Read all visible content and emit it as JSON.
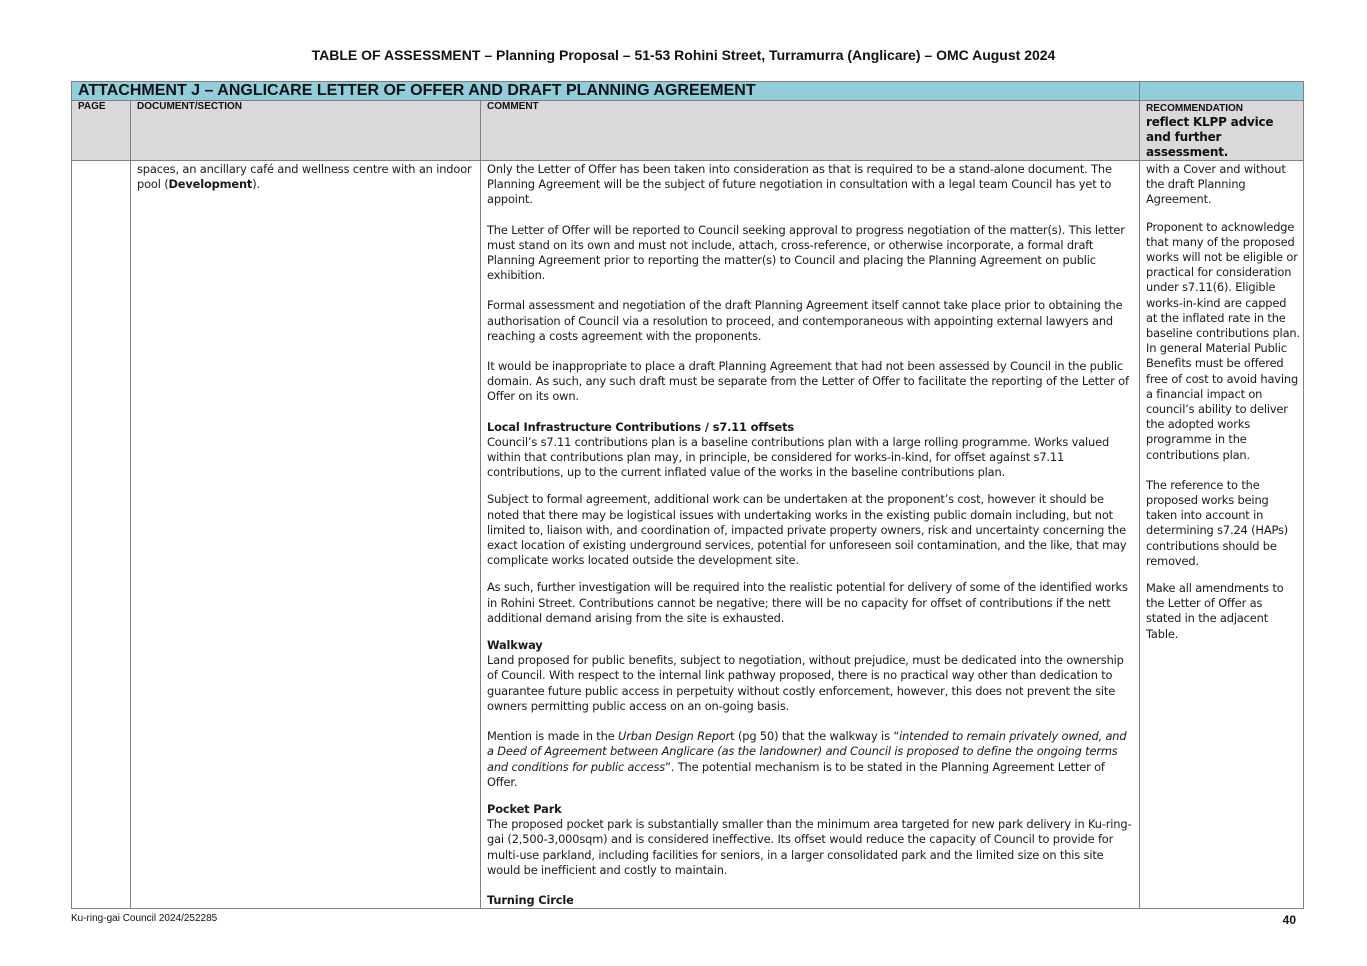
{
  "document": {
    "title": "TABLE OF ASSESSMENT – Planning Proposal – 51-53 Rohini Street, Turramurra (Anglicare) – OMC August 2024"
  },
  "table": {
    "attachment_title": "ATTACHMENT J – ANGLICARE LETTER OF OFFER AND DRAFT PLANNING AGREEMENT",
    "headers": {
      "page": "PAGE",
      "document_section": "DOCUMENT/SECTION",
      "comment": "COMMENT",
      "recommendation": "RECOMMENDATION",
      "recommendation_sub": "reflect KLPP advice and further assessment."
    },
    "row": {
      "page": "",
      "section_text_1": "spaces, an ancillary café and wellness centre with an indoor pool (",
      "section_bold": "Development",
      "section_text_2": ").",
      "comment": {
        "p1": "Only the Letter of Offer has been taken into consideration as that is required to be a stand-alone document. The Planning Agreement will be the subject of future negotiation in consultation with a legal team Council has yet to appoint.",
        "p2": "The Letter of Offer will be reported to Council seeking approval to progress negotiation of the matter(s). This letter must stand on its own and must not include, attach, cross-reference, or otherwise incorporate, a formal draft Planning Agreement prior to reporting the matter(s) to Council and placing the Planning Agreement on public exhibition.",
        "p3": "Formal assessment and negotiation of the draft Planning Agreement itself cannot take place prior to obtaining the authorisation of Council via a resolution to proceed, and contemporaneous with appointing external lawyers and reaching a costs agreement with the proponents.",
        "p4": "It would be inappropriate to place a draft Planning Agreement that had not been assessed by Council in the public domain. As such, any such draft must be separate from the Letter of Offer to facilitate the reporting of the Letter of Offer on its own.",
        "h_contrib": "Local Infrastructure Contributions / s7.11 offsets",
        "p5": "Council’s s7.11 contributions plan is a baseline contributions plan with a large rolling programme. Works valued within that contributions plan may, in principle, be considered for works-in-kind, for offset against s7.11 contributions, up to the current inflated value of the works in the baseline contributions plan.",
        "p6": "Subject to formal agreement, additional work can be undertaken at the proponent’s cost, however it should be noted that there may be logistical issues with undertaking works in the existing public domain including, but not limited to, liaison with, and coordination of, impacted private property owners, risk and uncertainty concerning the exact location of existing underground services, potential for unforeseen soil contamination, and the like, that may complicate works located outside the development site.",
        "p7": "As such, further investigation will be required into the realistic potential for delivery of some of the identified works in Rohini Street. Contributions cannot be negative; there will be no capacity for offset of contributions if the nett additional demand arising from the site is exhausted.",
        "h_walkway": "Walkway",
        "p8": "Land proposed for public benefits, subject to negotiation, without prejudice, must be dedicated into the ownership of Council. With respect to the internal link pathway proposed, there is no practical way other than dedication to guarantee future public access in perpetuity without costly enforcement, however, this does not prevent the site owners permitting public access on an on-going basis.",
        "p9_a": "Mention is made in the ",
        "p9_b": "Urban Design Repor",
        "p9_c": "t (pg 50) that the walkway is “",
        "p9_d": "intended to remain privately owned, and a Deed of Agreement between Anglicare (as the landowner) and Council is proposed to define the ongoing terms and conditions for public access",
        "p9_e": "”. The potential mechanism is to be stated in the Planning Agreement Letter of Offer.",
        "h_park": "Pocket Park",
        "p10": "The proposed pocket park is substantially smaller than the minimum area targeted for new park delivery in Ku-ring-gai (2,500-3,000sqm) and is considered ineffective. Its offset would reduce the capacity of Council to provide for multi-use parkland, including facilities for seniors, in a larger consolidated park and the limited size on this site would be inefficient and costly to maintain.",
        "h_turning": "Turning Circle"
      },
      "recommendation": {
        "r1": "with a Cover and without the draft Planning Agreement.",
        "r2": "Proponent to acknowledge that many of the proposed works will not be eligible or practical for consideration under s7.11(6). Eligible works-in-kind are capped at the inflated rate in the baseline contributions plan. In general Material Public Benefits must be offered free of cost to avoid having a financial impact on council’s ability to deliver the adopted works programme in the contributions plan.",
        "r3": "The reference to the proposed works being taken into account in determining s7.24 (HAPs) contributions should be removed.",
        "r4": "Make all amendments to the Letter of Offer as stated in the adjacent Table."
      }
    }
  },
  "footer": {
    "reference": "Ku-ring-gai Council 2024/252285",
    "page_number": "40"
  }
}
